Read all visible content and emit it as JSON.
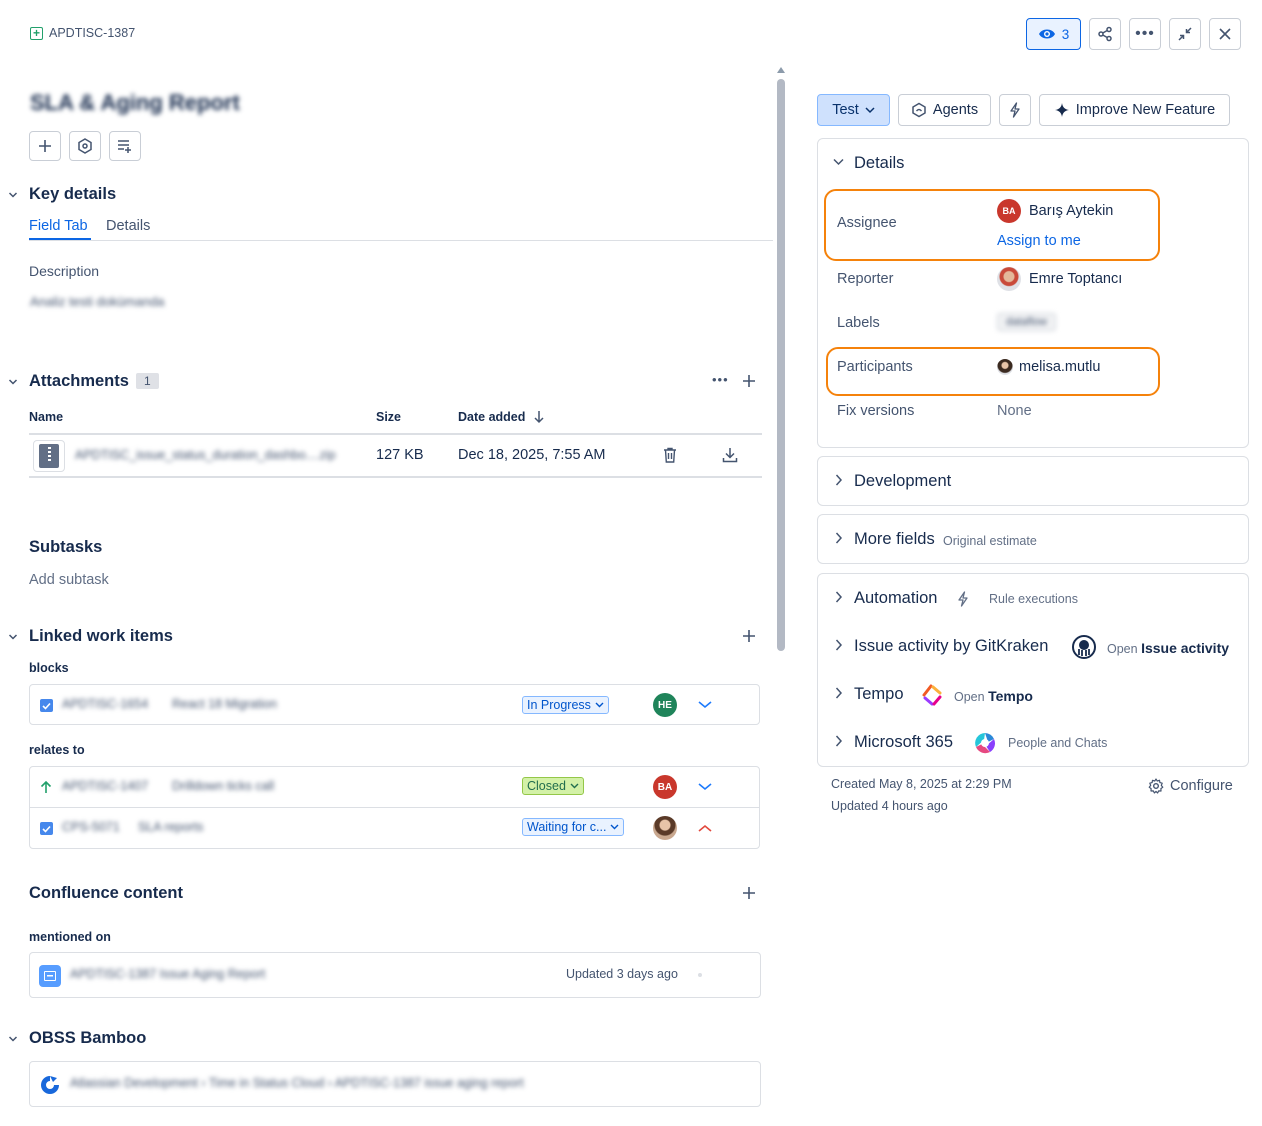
{
  "issue": {
    "key": "APDTISC-1387",
    "title": "SLA & Aging Report"
  },
  "header": {
    "watch_count": "3"
  },
  "key_details": {
    "title": "Key details",
    "tabs": [
      {
        "label": "Field Tab"
      },
      {
        "label": "Details"
      }
    ],
    "description_label": "Description",
    "description_value": "Analiz testi dokümanda"
  },
  "attachments": {
    "title": "Attachments",
    "count": "1",
    "columns": {
      "name": "Name",
      "size": "Size",
      "date": "Date added"
    },
    "rows": [
      {
        "name": "APDTISC_issue_status_duration_dashbo....zip",
        "size": "127 KB",
        "date": "Dec 18, 2025, 7:55 AM"
      }
    ]
  },
  "subtasks": {
    "title": "Subtasks",
    "add": "Add subtask"
  },
  "linked": {
    "title": "Linked work items",
    "groups": [
      {
        "label": "blocks",
        "items": [
          {
            "key": "APDTISC-1654",
            "summary": "React 18 Migration",
            "status": "In Progress",
            "avatar": "HE"
          }
        ]
      },
      {
        "label": "relates to",
        "items": [
          {
            "key": "APDTISC-1407",
            "summary": "Drilldown ticks call",
            "status": "Closed",
            "avatar": "BA"
          },
          {
            "key": "CPS-5071",
            "summary": "SLA reports",
            "status": "Waiting for c...",
            "avatar": ""
          }
        ]
      }
    ]
  },
  "confluence": {
    "title": "Confluence content",
    "subheading": "mentioned on",
    "page_title": "APDTISC-1387 Issue Aging Report",
    "updated": "Updated 3 days ago"
  },
  "bamboo": {
    "title": "OBSS Bamboo",
    "link": "Atlassian Development › Time in Status Cloud › APDTISC-1387 issue aging report"
  },
  "toolbar": {
    "status": "Test",
    "agents": "Agents",
    "improve": "Improve New Feature"
  },
  "details_panel": {
    "title": "Details",
    "assignee_label": "Assignee",
    "assignee_name": "Barış Aytekin",
    "assignee_initials": "BA",
    "assign_to_me": "Assign to me",
    "reporter_label": "Reporter",
    "reporter_name": "Emre Toptancı",
    "labels_label": "Labels",
    "labels_value": "dataflow",
    "participants_label": "Participants",
    "participants_name": "melisa.mutlu",
    "fix_versions_label": "Fix versions",
    "fix_versions_value": "None"
  },
  "development": {
    "title": "Development"
  },
  "more_fields": {
    "title": "More fields",
    "sub": "Original estimate"
  },
  "apps": {
    "automation": {
      "title": "Automation",
      "sub": "Rule executions"
    },
    "gitkraken": {
      "title": "Issue activity by GitKraken",
      "open": "Open",
      "target": "Issue activity"
    },
    "tempo": {
      "title": "Tempo",
      "open": "Open",
      "target": "Tempo"
    },
    "m365": {
      "title": "Microsoft 365",
      "sub": "People and Chats"
    }
  },
  "footer": {
    "created": "Created May 8, 2025 at 2:29 PM",
    "updated": "Updated 4 hours ago",
    "configure": "Configure"
  },
  "colors": {
    "accent": "#0c66e4",
    "highlight": "#f5820b",
    "in_progress_bg": "#e9f2ff",
    "closed_bg": "#dcfff1",
    "avatar_he": "#1f845a",
    "avatar_ba": "#c9372c"
  }
}
